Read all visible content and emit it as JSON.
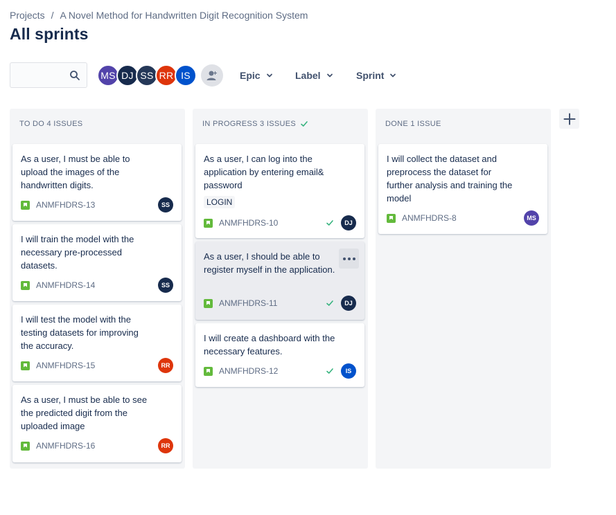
{
  "breadcrumb": {
    "root": "Projects",
    "separator": "/",
    "project": "A Novel Method for Handwritten Digit Recognition System"
  },
  "page": {
    "title": "All sprints"
  },
  "search": {
    "placeholder": "",
    "icon": "search-icon"
  },
  "avatars": [
    {
      "initials": "MS",
      "color": "#5243aa"
    },
    {
      "initials": "DJ",
      "color": "#172b4d"
    },
    {
      "initials": "SS",
      "color": "#253858"
    },
    {
      "initials": "RR",
      "color": "#de350b"
    },
    {
      "initials": "IS",
      "color": "#0052cc"
    }
  ],
  "filters": {
    "epic": "Epic",
    "label": "Label",
    "sprint": "Sprint"
  },
  "columns": [
    {
      "title": "TO DO 4 ISSUES",
      "cards": [
        {
          "text": "As a user, I must be able to upload the images of the handwritten digits.",
          "key": "ANMFHDRS-13",
          "assignee": "SS",
          "assignee_color": "#172b4d"
        },
        {
          "text": "I will train the model with the necessary pre-processed datasets.",
          "key": "ANMFHDRS-14",
          "assignee": "SS",
          "assignee_color": "#172b4d"
        },
        {
          "text": "I will test the model with the testing datasets for improving the accuracy.",
          "key": "ANMFHDRS-15",
          "assignee": "RR",
          "assignee_color": "#de350b"
        },
        {
          "text": "As a user, I must be able to see the predicted digit from the uploaded image",
          "key": "ANMFHDRS-16",
          "assignee": "RR",
          "assignee_color": "#de350b"
        }
      ]
    },
    {
      "title": "IN PROGRESS 3 ISSUES",
      "cards": [
        {
          "text": "As a user, I can log into the application by entering email& password",
          "label": "LOGIN",
          "key": "ANMFHDRS-10",
          "assignee": "DJ",
          "assignee_color": "#172b4d"
        },
        {
          "text": "As a user, I should be able to register myself in the application.",
          "key": "ANMFHDRS-11",
          "assignee": "DJ",
          "assignee_color": "#172b4d"
        },
        {
          "text": "I will create a dashboard with the necessary features.",
          "key": "ANMFHDRS-12",
          "assignee": "IS",
          "assignee_color": "#0052cc"
        }
      ]
    },
    {
      "title": "DONE 1 ISSUE",
      "cards": [
        {
          "text": "I will collect the dataset and preprocess the dataset for further analysis and training the model",
          "key": "ANMFHDRS-8",
          "assignee": "MS",
          "assignee_color": "#5243aa"
        }
      ]
    }
  ],
  "colors": {
    "story": "#63ba3c",
    "done_check": "#36b37e",
    "column_bg": "#f4f5f7"
  }
}
